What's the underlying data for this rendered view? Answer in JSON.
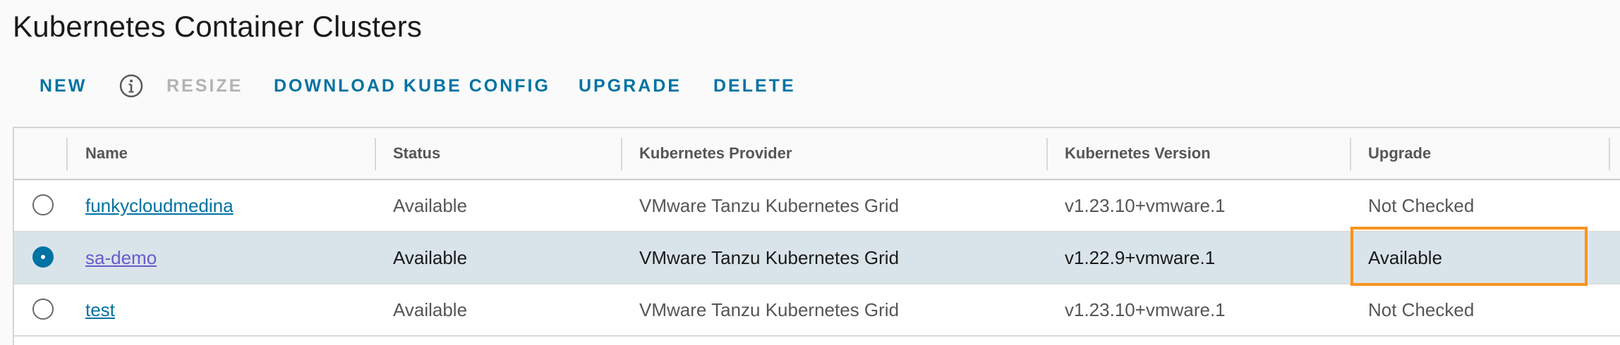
{
  "page": {
    "title": "Kubernetes Container Clusters"
  },
  "toolbar": {
    "new_label": "NEW",
    "resize_label": "RESIZE",
    "download_label": "DOWNLOAD KUBE CONFIG",
    "upgrade_label": "UPGRADE",
    "delete_label": "DELETE",
    "info_icon": "info-icon"
  },
  "table": {
    "columns": [
      "Name",
      "Status",
      "Kubernetes Provider",
      "Kubernetes Version",
      "Upgrade"
    ],
    "rows": [
      {
        "name": "funkycloudmedina",
        "status": "Available",
        "provider": "VMware Tanzu Kubernetes Grid",
        "version": "v1.23.10+vmware.1",
        "upgrade": "Not Checked",
        "selected": false
      },
      {
        "name": "sa-demo",
        "status": "Available",
        "provider": "VMware Tanzu Kubernetes Grid",
        "version": "v1.22.9+vmware.1",
        "upgrade": "Available",
        "selected": true
      },
      {
        "name": "test",
        "status": "Available",
        "provider": "VMware Tanzu Kubernetes Grid",
        "version": "v1.23.10+vmware.1",
        "upgrade": "Not Checked",
        "selected": false
      }
    ]
  },
  "colors": {
    "accent": "#0072a3",
    "selected_row": "#d9e4ea",
    "highlight": "#f7931e",
    "disabled": "#b3b3b3"
  }
}
